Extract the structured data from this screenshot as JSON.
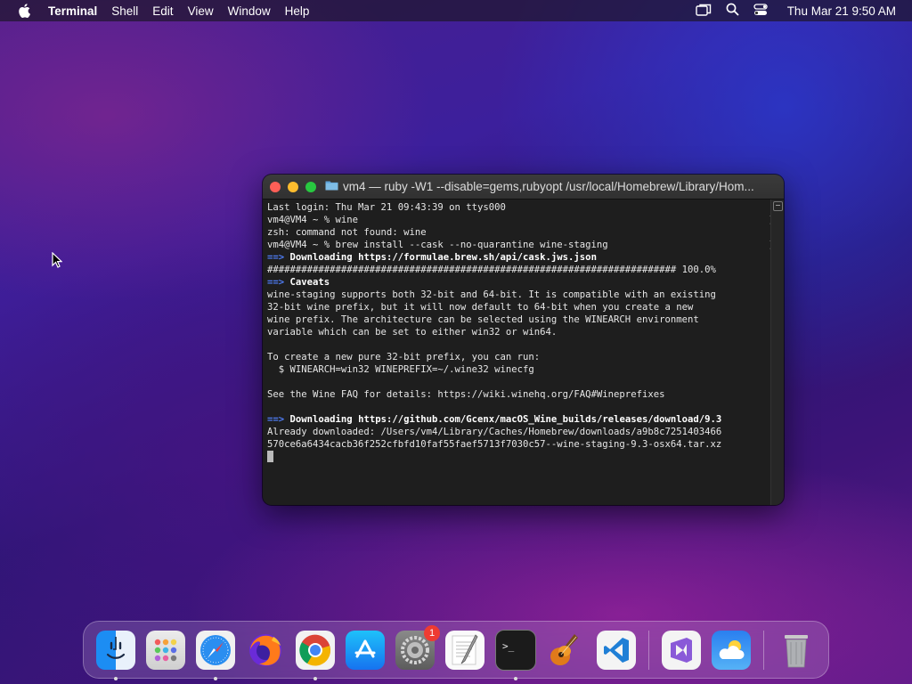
{
  "menubar": {
    "app_name": "Terminal",
    "items": [
      "Shell",
      "Edit",
      "View",
      "Window",
      "Help"
    ],
    "clock": "Thu Mar 21  9:50 AM"
  },
  "terminal": {
    "title": "vm4 — ruby -W1 --disable=gems,rubyopt /usr/local/Homebrew/Library/Hom...",
    "lines": [
      {
        "text": "Last login: Thu Mar 21 09:43:39 on ttys000"
      },
      {
        "text": "vm4@VM4 ~ % wine",
        "mark": true
      },
      {
        "text": "zsh: command not found: wine"
      },
      {
        "text": "vm4@VM4 ~ % brew install --cask --no-quarantine wine-staging",
        "mark": true
      },
      {
        "arrow": "==>",
        "text": "Downloading https://formulae.brew.sh/api/cask.jws.json",
        "bold": true
      },
      {
        "text": "######################################################################## 100.0%"
      },
      {
        "arrow": "==>",
        "text": "Caveats",
        "bold": true
      },
      {
        "text": "wine-staging supports both 32-bit and 64-bit. It is compatible with an existing"
      },
      {
        "text": "32-bit wine prefix, but it will now default to 64-bit when you create a new"
      },
      {
        "text": "wine prefix. The architecture can be selected using the WINEARCH environment"
      },
      {
        "text": "variable which can be set to either win32 or win64."
      },
      {
        "text": ""
      },
      {
        "text": "To create a new pure 32-bit prefix, you can run:"
      },
      {
        "text": "  $ WINEARCH=win32 WINEPREFIX=~/.wine32 winecfg"
      },
      {
        "text": ""
      },
      {
        "text": "See the Wine FAQ for details: https://wiki.winehq.org/FAQ#Wineprefixes"
      },
      {
        "text": ""
      },
      {
        "arrow": "==>",
        "text": "Downloading https://github.com/Gcenx/macOS_Wine_builds/releases/download/9.3",
        "bold": true
      },
      {
        "text": "Already downloaded: /Users/vm4/Library/Caches/Homebrew/downloads/a9b8c7251403466"
      },
      {
        "text": "570ce6a6434cacb36f252cfbfd10faf55faef5713f7030c57--wine-staging-9.3-osx64.tar.xz"
      }
    ]
  },
  "dock": {
    "apps": [
      {
        "name": "finder",
        "running": true
      },
      {
        "name": "launchpad",
        "running": false
      },
      {
        "name": "safari",
        "running": true
      },
      {
        "name": "firefox",
        "running": false
      },
      {
        "name": "chrome",
        "running": true
      },
      {
        "name": "app-store",
        "running": false
      },
      {
        "name": "system-preferences",
        "running": false,
        "badge": "1"
      },
      {
        "name": "textedit",
        "running": false
      },
      {
        "name": "terminal",
        "running": true
      },
      {
        "name": "garageband",
        "running": false
      },
      {
        "name": "vscode",
        "running": false
      },
      {
        "name": "visual-studio",
        "running": false
      },
      {
        "name": "weather",
        "running": false
      },
      {
        "name": "trash",
        "running": false
      }
    ]
  }
}
